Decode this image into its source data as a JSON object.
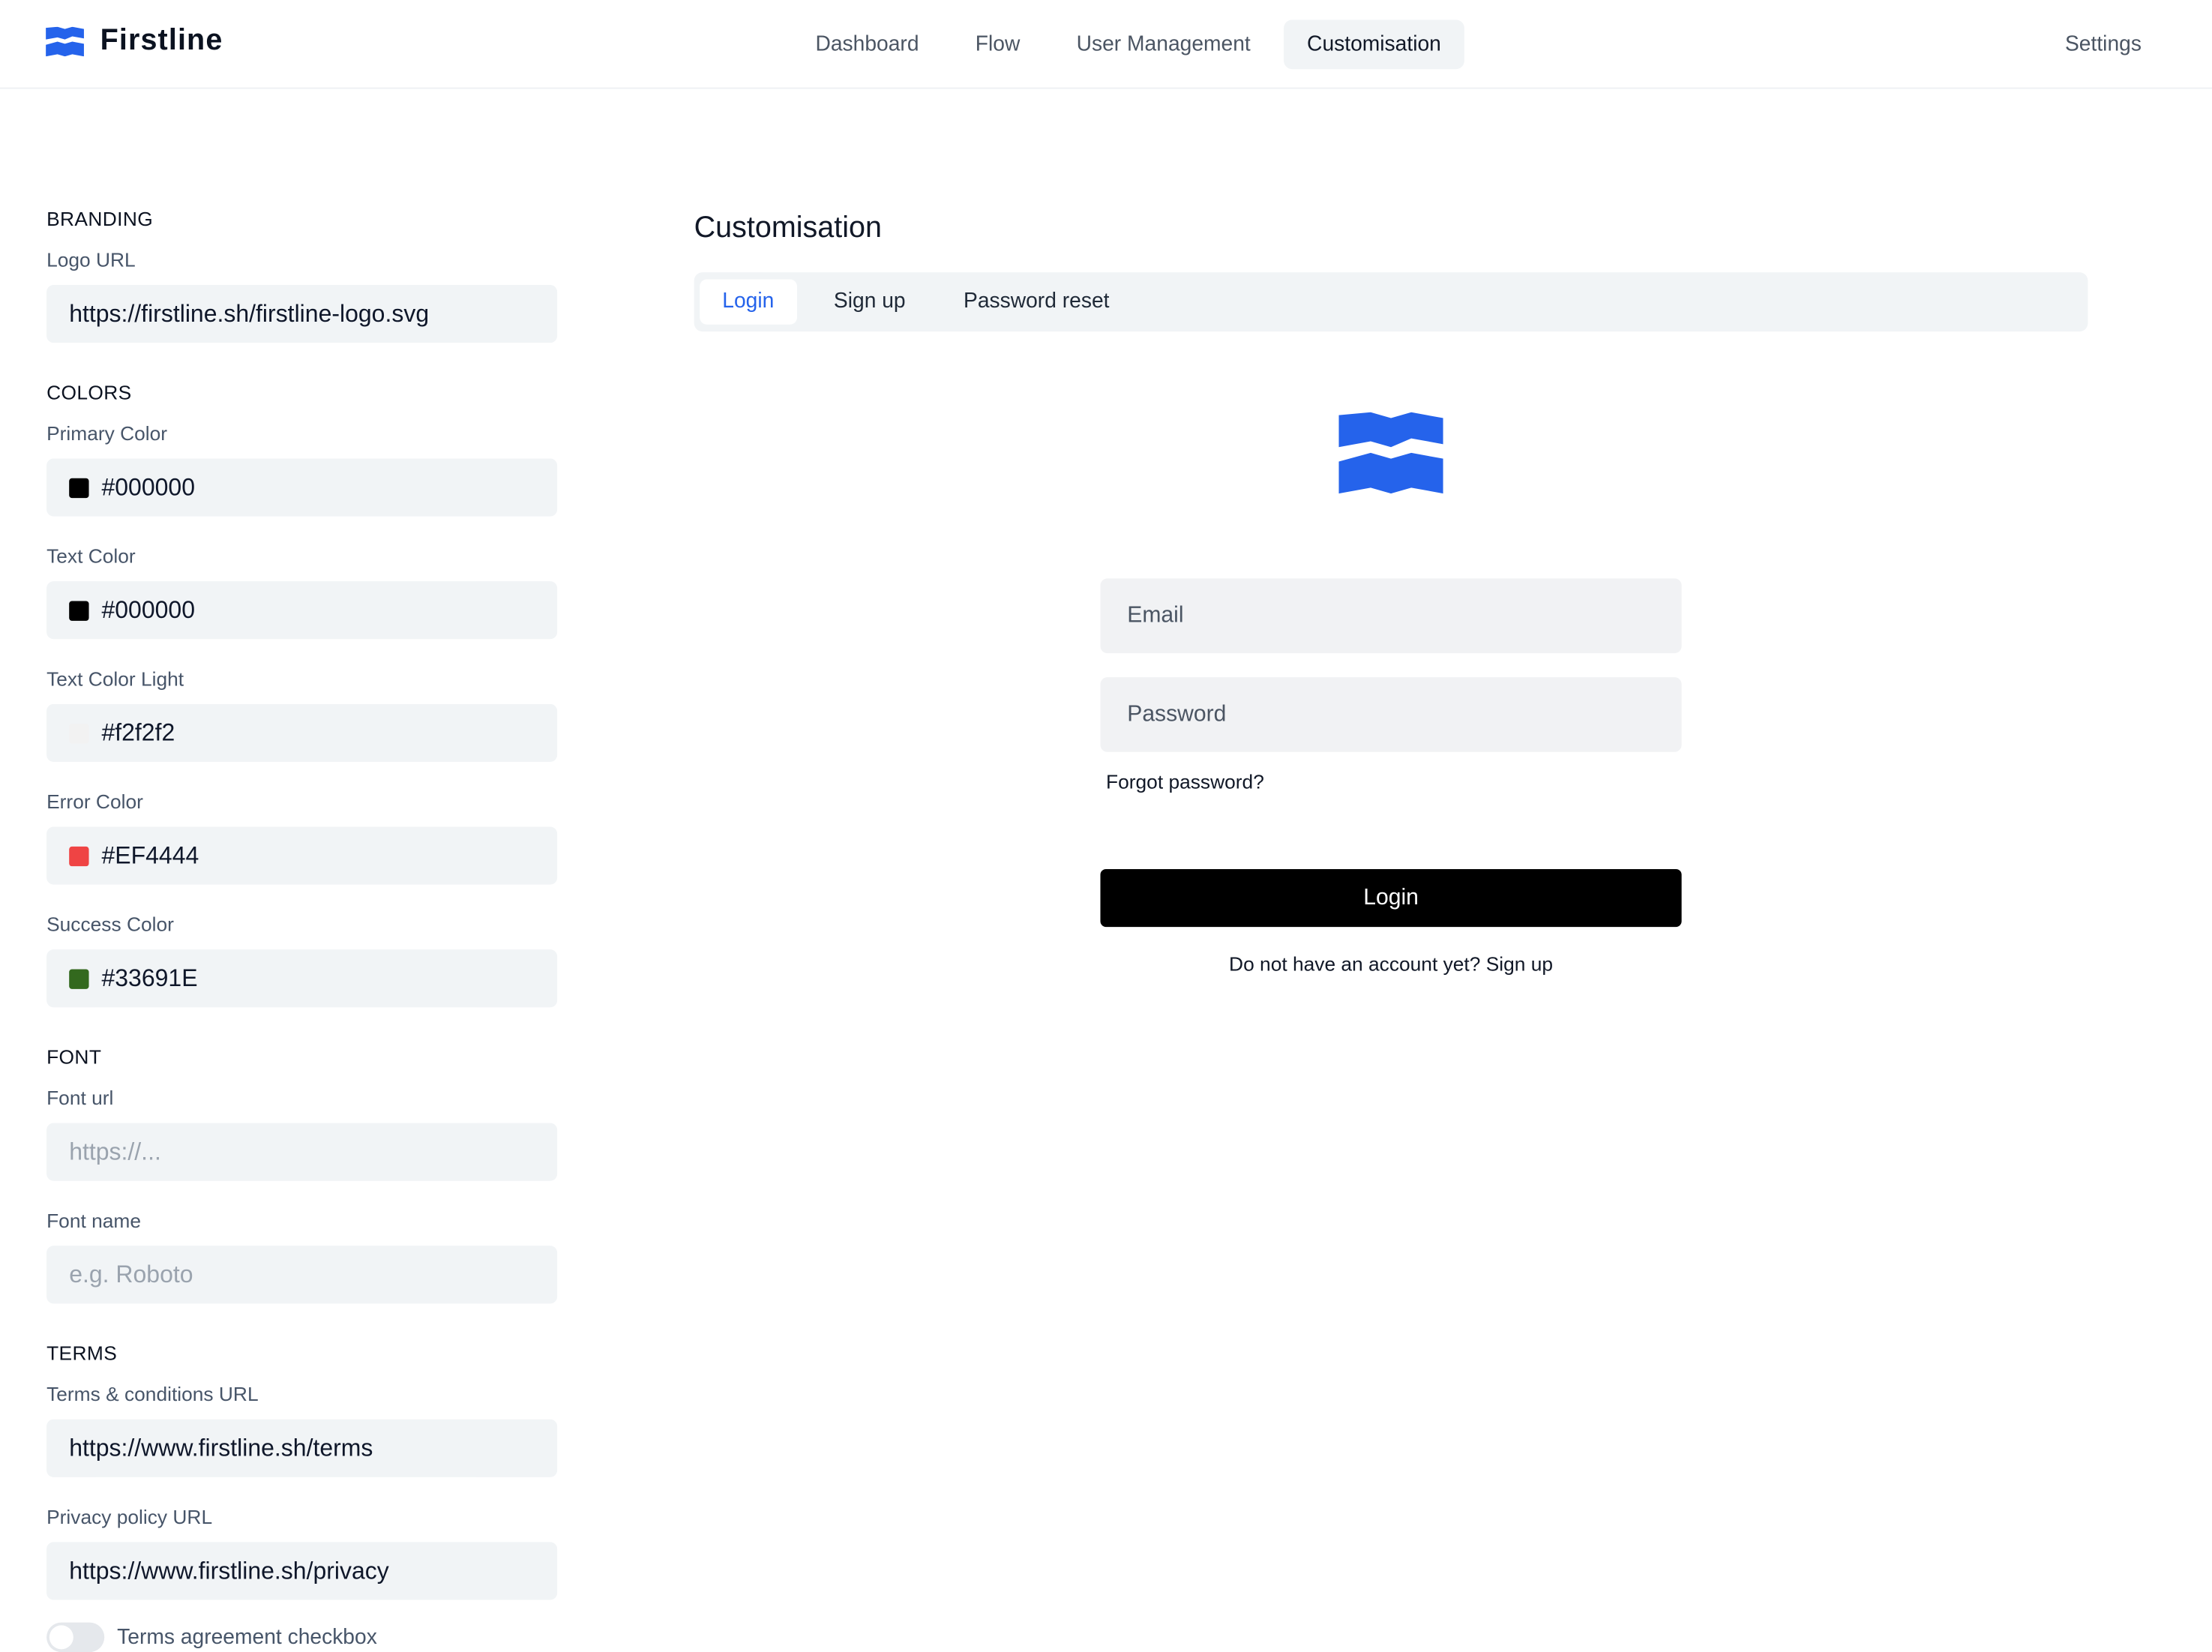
{
  "app": {
    "name": "Firstline",
    "brand_color": "#2563EB"
  },
  "nav": {
    "items": [
      "Dashboard",
      "Flow",
      "User Management",
      "Customisation"
    ],
    "active": "Customisation",
    "settings": "Settings"
  },
  "branding": {
    "title": "BRANDING",
    "logo_url_label": "Logo URL",
    "logo_url_value": "https://firstline.sh/firstline-logo.svg"
  },
  "colors": {
    "title": "COLORS",
    "primary": {
      "label": "Primary Color",
      "value": "#000000",
      "swatch": "#000000"
    },
    "text": {
      "label": "Text Color",
      "value": "#000000",
      "swatch": "#000000"
    },
    "text_light": {
      "label": "Text Color Light",
      "value": "#f2f2f2",
      "swatch": "#f2f2f2"
    },
    "error": {
      "label": "Error Color",
      "value": "#EF4444",
      "swatch": "#EF4444"
    },
    "success": {
      "label": "Success Color",
      "value": "#33691E",
      "swatch": "#33691E"
    }
  },
  "font": {
    "title": "FONT",
    "url_label": "Font url",
    "url_placeholder": "https://...",
    "name_label": "Font name",
    "name_placeholder": "e.g. Roboto"
  },
  "terms": {
    "title": "TERMS",
    "terms_label": "Terms & conditions URL",
    "terms_value": "https://www.firstline.sh/terms",
    "privacy_label": "Privacy policy URL",
    "privacy_value": "https://www.firstline.sh/privacy",
    "checkbox_label": "Terms agreement checkbox",
    "checkbox_enabled": false
  },
  "preview": {
    "title": "Customisation",
    "tabs": [
      "Login",
      "Sign up",
      "Password reset"
    ],
    "active_tab": "Login",
    "email_placeholder": "Email",
    "password_placeholder": "Password",
    "forgot_password": "Forgot password?",
    "login_button": "Login",
    "signup_prompt": "Do not have an account yet?",
    "signup_link": "Sign up"
  }
}
